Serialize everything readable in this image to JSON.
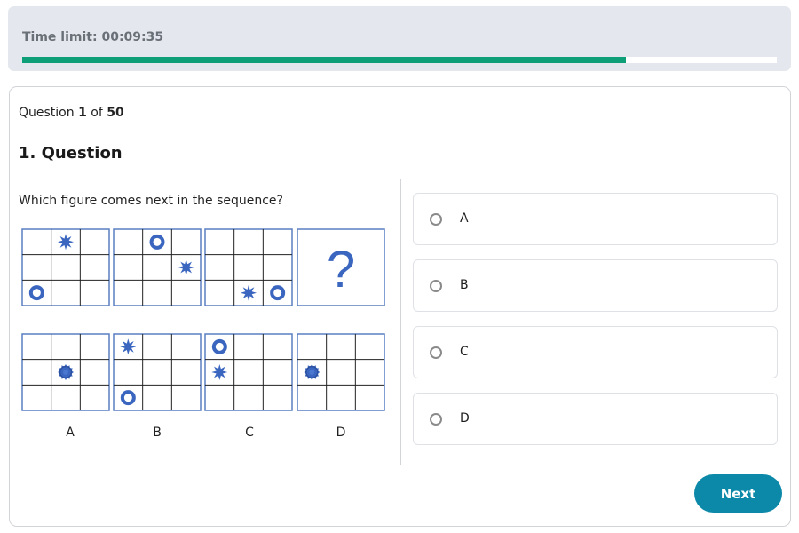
{
  "timer": {
    "label": "Time limit: 00:09:35",
    "progress_fraction": 0.8,
    "progress_color": "#0e9e78"
  },
  "question": {
    "count_prefix": "Question ",
    "current": "1",
    "count_mid": " of ",
    "total": "50",
    "title": "1. Question",
    "text": "Which figure comes next in the sequence?"
  },
  "figures": {
    "shape_color": "#3a66c0",
    "border_color": "#5a7ec0",
    "sequence": [
      {
        "cells": [
          {
            "row": 0,
            "col": 1,
            "shape": "star"
          },
          {
            "row": 2,
            "col": 0,
            "shape": "ring"
          }
        ]
      },
      {
        "cells": [
          {
            "row": 0,
            "col": 1,
            "shape": "ring"
          },
          {
            "row": 1,
            "col": 2,
            "shape": "star"
          }
        ]
      },
      {
        "cells": [
          {
            "row": 2,
            "col": 1,
            "shape": "star"
          },
          {
            "row": 2,
            "col": 2,
            "shape": "ring"
          }
        ]
      }
    ],
    "unknown_symbol": "?",
    "choices": [
      {
        "label": "A",
        "cells": [
          {
            "row": 1,
            "col": 1,
            "shape": "combined"
          }
        ]
      },
      {
        "label": "B",
        "cells": [
          {
            "row": 0,
            "col": 0,
            "shape": "star"
          },
          {
            "row": 2,
            "col": 0,
            "shape": "ring"
          }
        ]
      },
      {
        "label": "C",
        "cells": [
          {
            "row": 0,
            "col": 0,
            "shape": "ring"
          },
          {
            "row": 1,
            "col": 0,
            "shape": "star"
          }
        ]
      },
      {
        "label": "D",
        "cells": [
          {
            "row": 1,
            "col": 0,
            "shape": "combined"
          }
        ]
      }
    ]
  },
  "answers": [
    {
      "label": "A",
      "selected": false
    },
    {
      "label": "B",
      "selected": false
    },
    {
      "label": "C",
      "selected": false
    },
    {
      "label": "D",
      "selected": false
    }
  ],
  "footer": {
    "next_label": "Next"
  }
}
